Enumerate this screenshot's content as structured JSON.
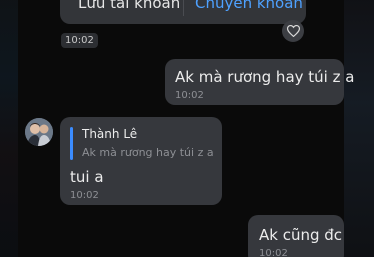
{
  "top_card": {
    "save_account_label": "Lưu tài khoản",
    "transfer_label": "Chuyển khoản",
    "timestamp": "10:02"
  },
  "messages": [
    {
      "direction": "outgoing",
      "text": "Ak mà rương hay túi z a",
      "time": "10:02"
    },
    {
      "direction": "incoming",
      "quote": {
        "sender": "Thành Lê",
        "text": "Ak mà rương hay túi z a"
      },
      "text": "tui a",
      "time": "10:02"
    },
    {
      "direction": "outgoing",
      "text": "Ak cũng đc",
      "time": "10:02"
    }
  ],
  "colors": {
    "background": "#0a0a0a",
    "bubble": "#36383d",
    "accent": "#3b8cff",
    "link": "#4ea1ff",
    "text": "#ececec",
    "muted": "#8d8f94"
  },
  "icons": {
    "reaction": "heart-icon"
  }
}
